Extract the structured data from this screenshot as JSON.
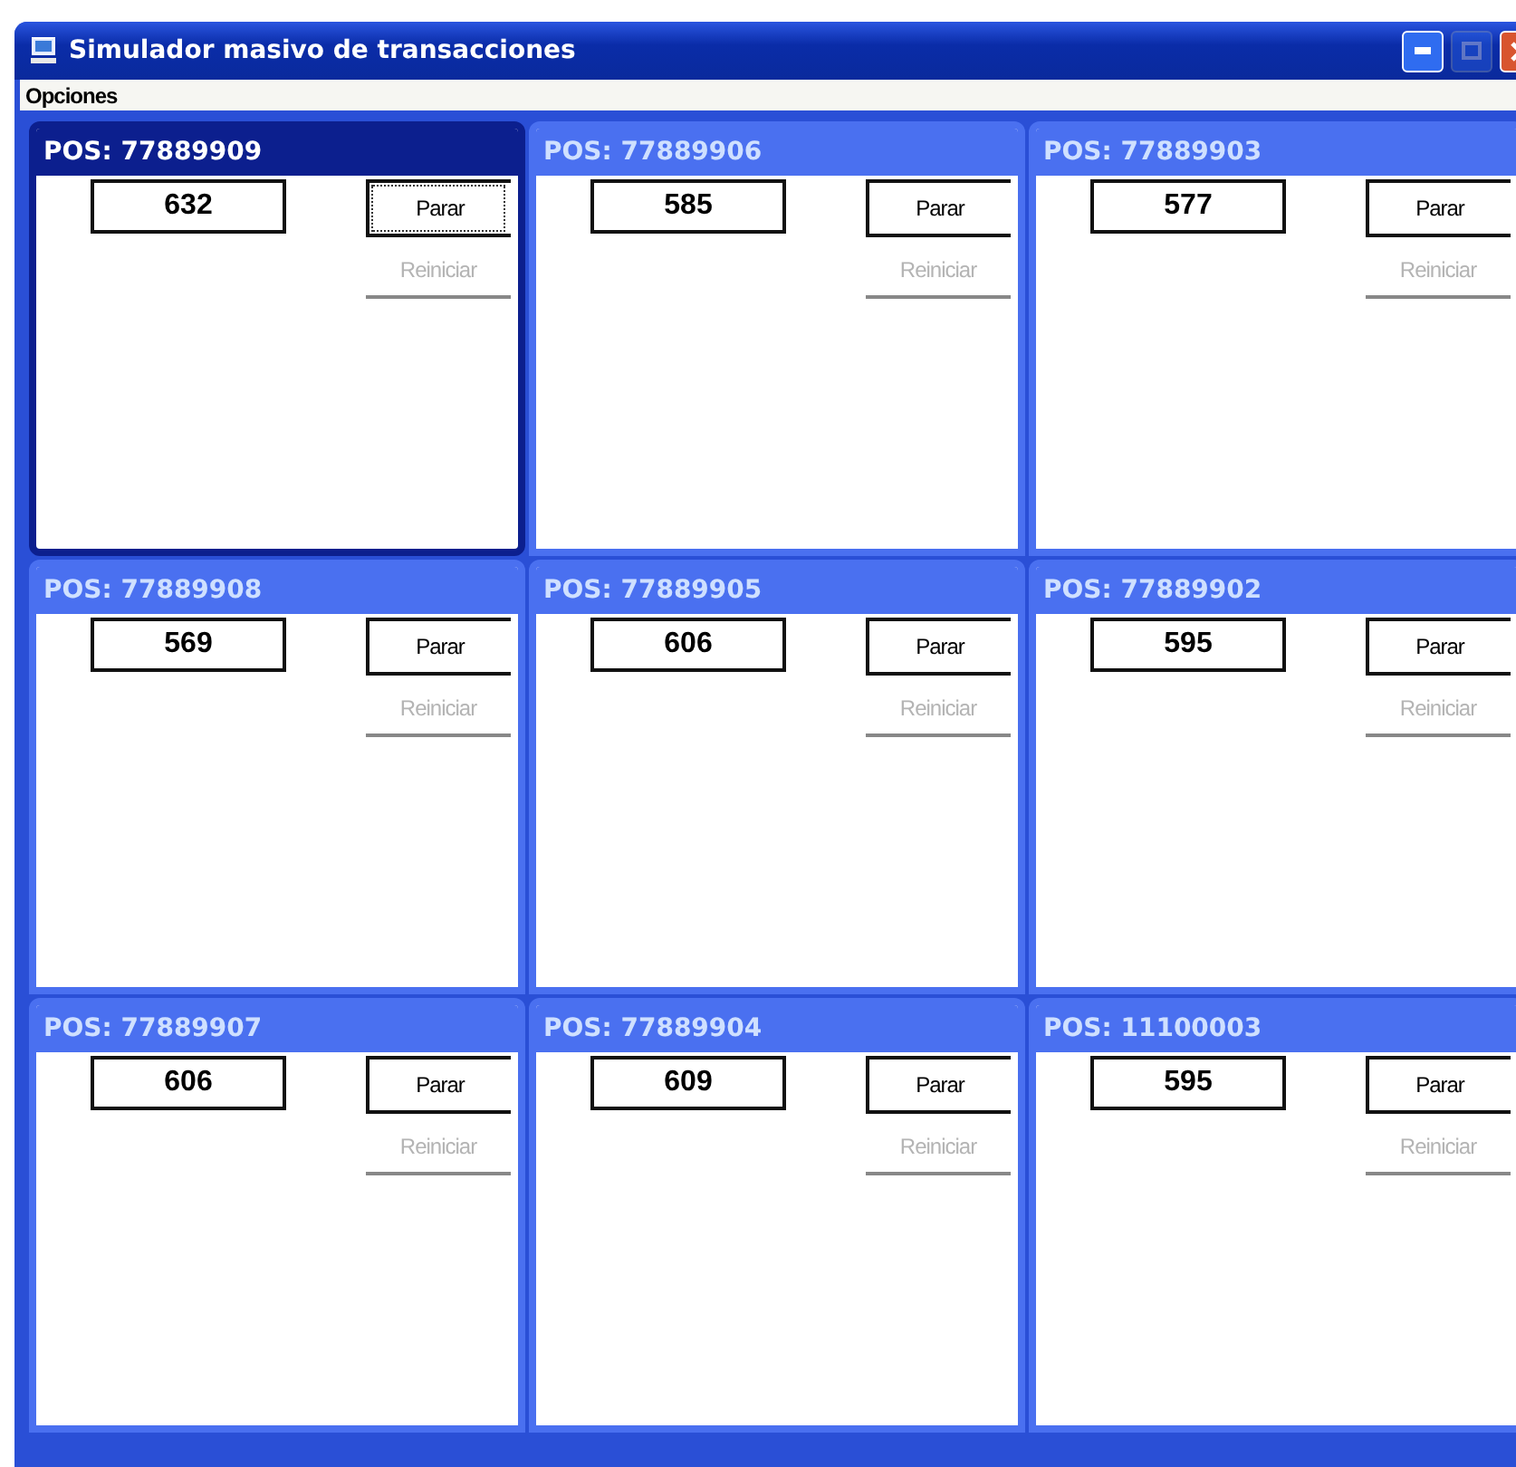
{
  "window": {
    "title": "Simulador masivo de transacciones",
    "title_buttons": [
      {
        "kind": "minimize",
        "disabled": false
      },
      {
        "kind": "maximize",
        "disabled": true
      },
      {
        "kind": "close",
        "disabled": false
      }
    ]
  },
  "menu": [
    {
      "label": "Opciones"
    }
  ],
  "panels": [
    {
      "title": "POS: 77889909",
      "value": "632",
      "selected": true,
      "buttons": [
        {
          "label": "Parar",
          "disabled": false
        },
        {
          "label": "Reiniciar",
          "disabled": true
        }
      ]
    },
    {
      "title": "POS: 77889906",
      "value": "585",
      "selected": false,
      "buttons": [
        {
          "label": "Parar",
          "disabled": false
        },
        {
          "label": "Reiniciar",
          "disabled": true
        }
      ]
    },
    {
      "title": "POS: 77889903",
      "value": "577",
      "selected": false,
      "buttons": [
        {
          "label": "Parar",
          "disabled": false
        },
        {
          "label": "Reiniciar",
          "disabled": true
        }
      ]
    },
    {
      "title": "POS: 77889908",
      "value": "569",
      "selected": false,
      "buttons": [
        {
          "label": "Parar",
          "disabled": false
        },
        {
          "label": "Reiniciar",
          "disabled": true
        }
      ]
    },
    {
      "title": "POS: 77889905",
      "value": "606",
      "selected": false,
      "buttons": [
        {
          "label": "Parar",
          "disabled": false
        },
        {
          "label": "Reiniciar",
          "disabled": true
        }
      ]
    },
    {
      "title": "POS: 77889902",
      "value": "595",
      "selected": false,
      "buttons": [
        {
          "label": "Parar",
          "disabled": false
        },
        {
          "label": "Reiniciar",
          "disabled": true
        }
      ]
    },
    {
      "title": "POS: 77889907",
      "value": "606",
      "selected": false,
      "buttons": [
        {
          "label": "Parar",
          "disabled": false
        },
        {
          "label": "Reiniciar",
          "disabled": true
        }
      ]
    },
    {
      "title": "POS: 77889904",
      "value": "609",
      "selected": false,
      "buttons": [
        {
          "label": "Parar",
          "disabled": false
        },
        {
          "label": "Reiniciar",
          "disabled": true
        }
      ]
    },
    {
      "title": "POS: 11100003",
      "value": "595",
      "selected": false,
      "buttons": [
        {
          "label": "Parar",
          "disabled": false
        },
        {
          "label": "Reiniciar",
          "disabled": true
        }
      ]
    }
  ]
}
